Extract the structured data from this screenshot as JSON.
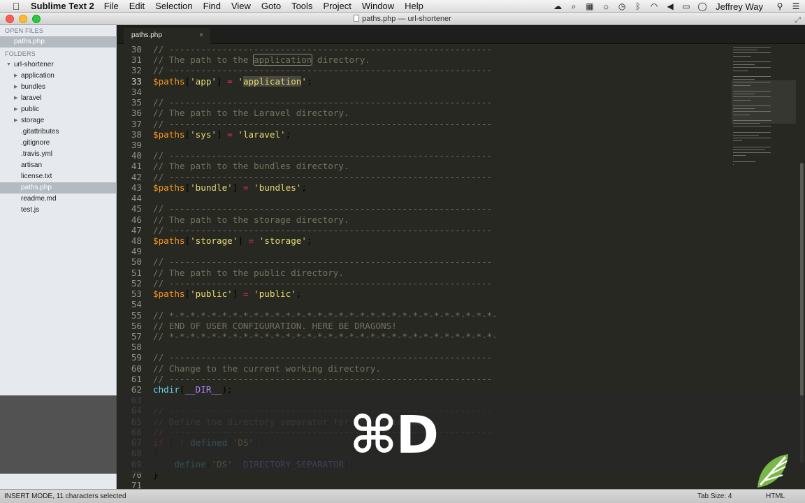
{
  "menubar": {
    "app_name": "Sublime Text 2",
    "items": [
      "File",
      "Edit",
      "Selection",
      "Find",
      "View",
      "Goto",
      "Tools",
      "Project",
      "Window",
      "Help"
    ],
    "user": "Jeffrey Way"
  },
  "window": {
    "title": "paths.php — url-shortener"
  },
  "sidebar": {
    "open_files_header": "OPEN FILES",
    "open_files": [
      {
        "label": "paths.php"
      }
    ],
    "folders_header": "FOLDERS",
    "root": "url-shortener",
    "folders": [
      {
        "label": "application"
      },
      {
        "label": "bundles"
      },
      {
        "label": "laravel"
      },
      {
        "label": "public"
      },
      {
        "label": "storage"
      }
    ],
    "files": [
      {
        "label": ".gitattributes"
      },
      {
        "label": ".gitignore"
      },
      {
        "label": ".travis.yml"
      },
      {
        "label": "artisan"
      },
      {
        "label": "license.txt"
      },
      {
        "label": "paths.php"
      },
      {
        "label": "readme.md"
      },
      {
        "label": "test.js"
      }
    ]
  },
  "tab": {
    "label": "paths.php",
    "close": "×"
  },
  "code_lines": [
    {
      "no": "30",
      "text": "// -------------------------------------------------------------"
    },
    {
      "no": "31",
      "text": "// The path to the application directory."
    },
    {
      "no": "32",
      "text": "// -------------------------------------------------------------"
    },
    {
      "no": "33",
      "text": "$paths['app'] = 'application';"
    },
    {
      "no": "34",
      "text": ""
    },
    {
      "no": "35",
      "text": "// -------------------------------------------------------------"
    },
    {
      "no": "36",
      "text": "// The path to the Laravel directory."
    },
    {
      "no": "37",
      "text": "// -------------------------------------------------------------"
    },
    {
      "no": "38",
      "text": "$paths['sys'] = 'laravel';"
    },
    {
      "no": "39",
      "text": ""
    },
    {
      "no": "40",
      "text": "// -------------------------------------------------------------"
    },
    {
      "no": "41",
      "text": "// The path to the bundles directory."
    },
    {
      "no": "42",
      "text": "// -------------------------------------------------------------"
    },
    {
      "no": "43",
      "text": "$paths['bundle'] = 'bundles';"
    },
    {
      "no": "44",
      "text": ""
    },
    {
      "no": "45",
      "text": "// -------------------------------------------------------------"
    },
    {
      "no": "46",
      "text": "// The path to the storage directory."
    },
    {
      "no": "47",
      "text": "// -------------------------------------------------------------"
    },
    {
      "no": "48",
      "text": "$paths['storage'] = 'storage';"
    },
    {
      "no": "49",
      "text": ""
    },
    {
      "no": "50",
      "text": "// -------------------------------------------------------------"
    },
    {
      "no": "51",
      "text": "// The path to the public directory."
    },
    {
      "no": "52",
      "text": "// -------------------------------------------------------------"
    },
    {
      "no": "53",
      "text": "$paths['public'] = 'public';"
    },
    {
      "no": "54",
      "text": ""
    },
    {
      "no": "55",
      "text": "// *-*-*-*-*-*-*-*-*-*-*-*-*-*-*-*-*-*-*-*-*-*-*-*-*-*-*-*-*-*-*-"
    },
    {
      "no": "56",
      "text": "// END OF USER CONFIGURATION. HERE BE DRAGONS!"
    },
    {
      "no": "57",
      "text": "// *-*-*-*-*-*-*-*-*-*-*-*-*-*-*-*-*-*-*-*-*-*-*-*-*-*-*-*-*-*-*-"
    },
    {
      "no": "58",
      "text": ""
    },
    {
      "no": "59",
      "text": "// -------------------------------------------------------------"
    },
    {
      "no": "60",
      "text": "// Change to the current working directory."
    },
    {
      "no": "61",
      "text": "// -------------------------------------------------------------"
    },
    {
      "no": "62",
      "text": "chdir(__DIR__);"
    },
    {
      "no": "63",
      "text": ""
    },
    {
      "no": "64",
      "text": "// -------------------------------------------------------------"
    },
    {
      "no": "65",
      "text": "// Define the directory separator for the environment."
    },
    {
      "no": "66",
      "text": "// -------------------------------------------------------------"
    },
    {
      "no": "67",
      "text": "if ( ! defined('DS'))"
    },
    {
      "no": "68",
      "text": "{"
    },
    {
      "no": "69",
      "text": "    define('DS', DIRECTORY_SEPARATOR);"
    },
    {
      "no": "70",
      "text": "}"
    },
    {
      "no": "71",
      "text": ""
    }
  ],
  "overlay": {
    "keys": "⌘D"
  },
  "statusbar": {
    "mode": "INSERT MODE, 11 characters selected",
    "tab_size": "Tab Size: 4",
    "syntax": "HTML"
  },
  "icons": {
    "apple": "apple-icon",
    "leaf": "leaf-logo-icon"
  }
}
